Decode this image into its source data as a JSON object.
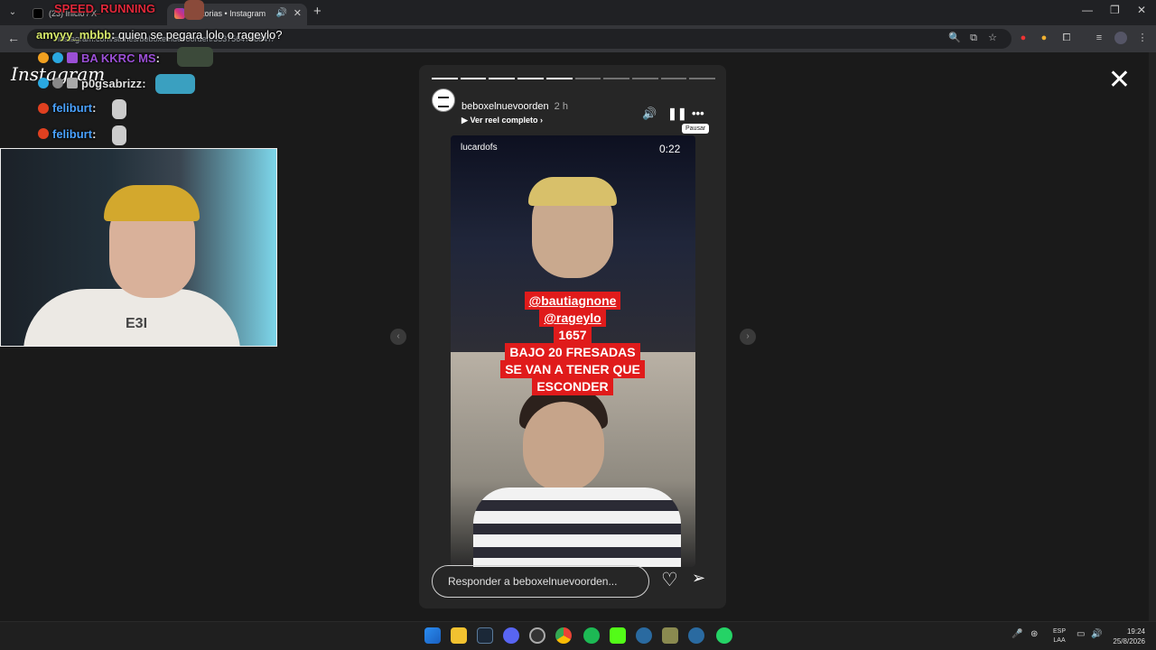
{
  "browser": {
    "tabs": [
      {
        "label": "(23) Inicio / X"
      },
      {
        "label": "Historias • Instagram"
      }
    ],
    "new_tab": "+",
    "url": "instagram.com/stories/beboxelnuevoorden/3537564768847/",
    "window_controls": [
      "—",
      "❐",
      "✕"
    ]
  },
  "page": {
    "logo": "Instagram",
    "close": "✕"
  },
  "story": {
    "username": "beboxelnuevoorden",
    "time": "2 h",
    "reel_link": "Ver reel completo",
    "tooltip": "Pausar",
    "progress_segments": 10,
    "progress_done": 5,
    "video": {
      "credit": "lucardofs",
      "duration": "0:22",
      "caption": [
        "@bautiagnone",
        "@rageylo",
        "1657",
        "BAJO 20 FRESADAS",
        "SE VAN A TENER QUE",
        "ESCONDER"
      ]
    },
    "reply_placeholder": "Responder a beboxelnuevoorden..."
  },
  "overlay": {
    "streamer_name": "SPEED_RUNNING",
    "chat": [
      {
        "user": "amyyy_mbbb",
        "text": "quien se pegara lolo o rageylo?",
        "color": "#d6e86a"
      },
      {
        "user": "BA KKRC MS",
        "text": "",
        "color": "#9b4fd6"
      },
      {
        "user": "p0gsabrizz",
        "text": "",
        "color": "#e0e0e0"
      },
      {
        "user": "feliburt",
        "text": "",
        "color": "#4aa2ff"
      },
      {
        "user": "feliburt",
        "text": "",
        "color": "#4aa2ff"
      }
    ],
    "shirt_text": "E3I"
  },
  "taskbar": {
    "lang": [
      "ESP",
      "LAA"
    ],
    "time": "19:24",
    "date": "25/8/2026"
  },
  "colors": {
    "caption_red": "#e01b1b",
    "bg": "#1a1a1a"
  }
}
